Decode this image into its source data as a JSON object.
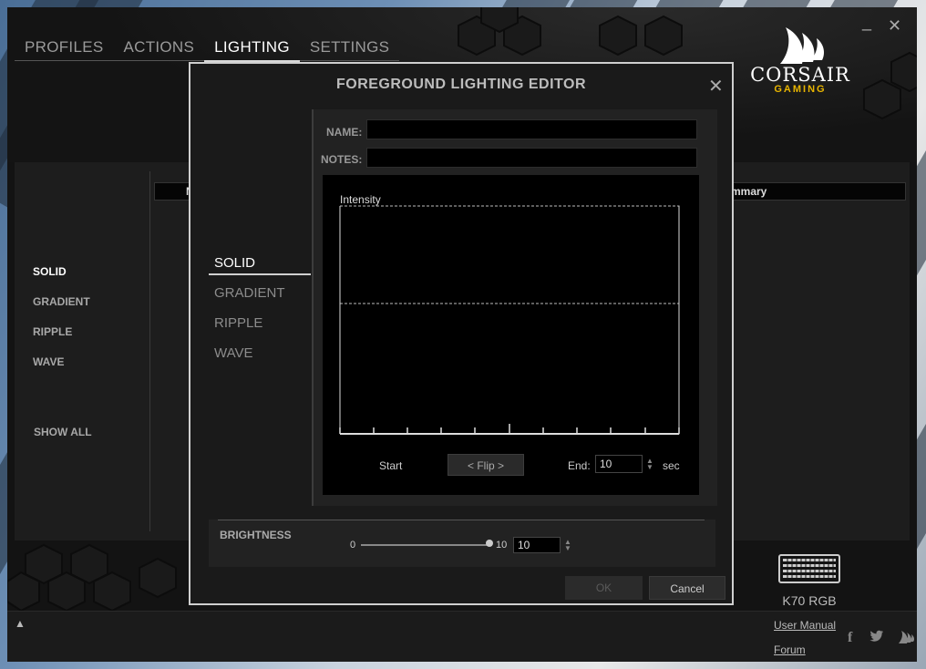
{
  "window": {
    "minimize_icon": "minimize-icon",
    "close_icon": "close-icon"
  },
  "tabs": [
    {
      "label": "PROFILES",
      "active": false
    },
    {
      "label": "ACTIONS",
      "active": false
    },
    {
      "label": "LIGHTING",
      "active": true
    },
    {
      "label": "SETTINGS",
      "active": false
    }
  ],
  "logo": {
    "name": "CORSAIR",
    "sub": "GAMING"
  },
  "lighting_nav": [
    "SOLID",
    "GRADIENT",
    "RIPPLE",
    "WAVE",
    "SHOW ALL"
  ],
  "table": {
    "col1": "Na",
    "col2": "mmary"
  },
  "modal": {
    "title": "FOREGROUND LIGHTING EDITOR",
    "effects": [
      "SOLID",
      "GRADIENT",
      "RIPPLE",
      "WAVE"
    ],
    "name_label": "NAME:",
    "name_value": "",
    "notes_label": "NOTES:",
    "notes_value": "",
    "graph": {
      "label": "Intensity",
      "start_label": "Start",
      "flip_label": "< Flip >",
      "end_label": "End:",
      "end_value": "10",
      "sec_label": "sec"
    },
    "brightness": {
      "label": "BRIGHTNESS",
      "min": "0",
      "max": "10",
      "value": "10",
      "level_fraction": 1.0
    },
    "ok_label": "OK",
    "cancel_label": "Cancel"
  },
  "device": {
    "name": "K70 RGB"
  },
  "footer": {
    "user_manual": "User Manual",
    "forum": "Forum",
    "facebook": "f"
  },
  "colors": {
    "accent_logo": "#e8b500",
    "panel": "#1d1d1d",
    "graph_bg": "#000000"
  }
}
